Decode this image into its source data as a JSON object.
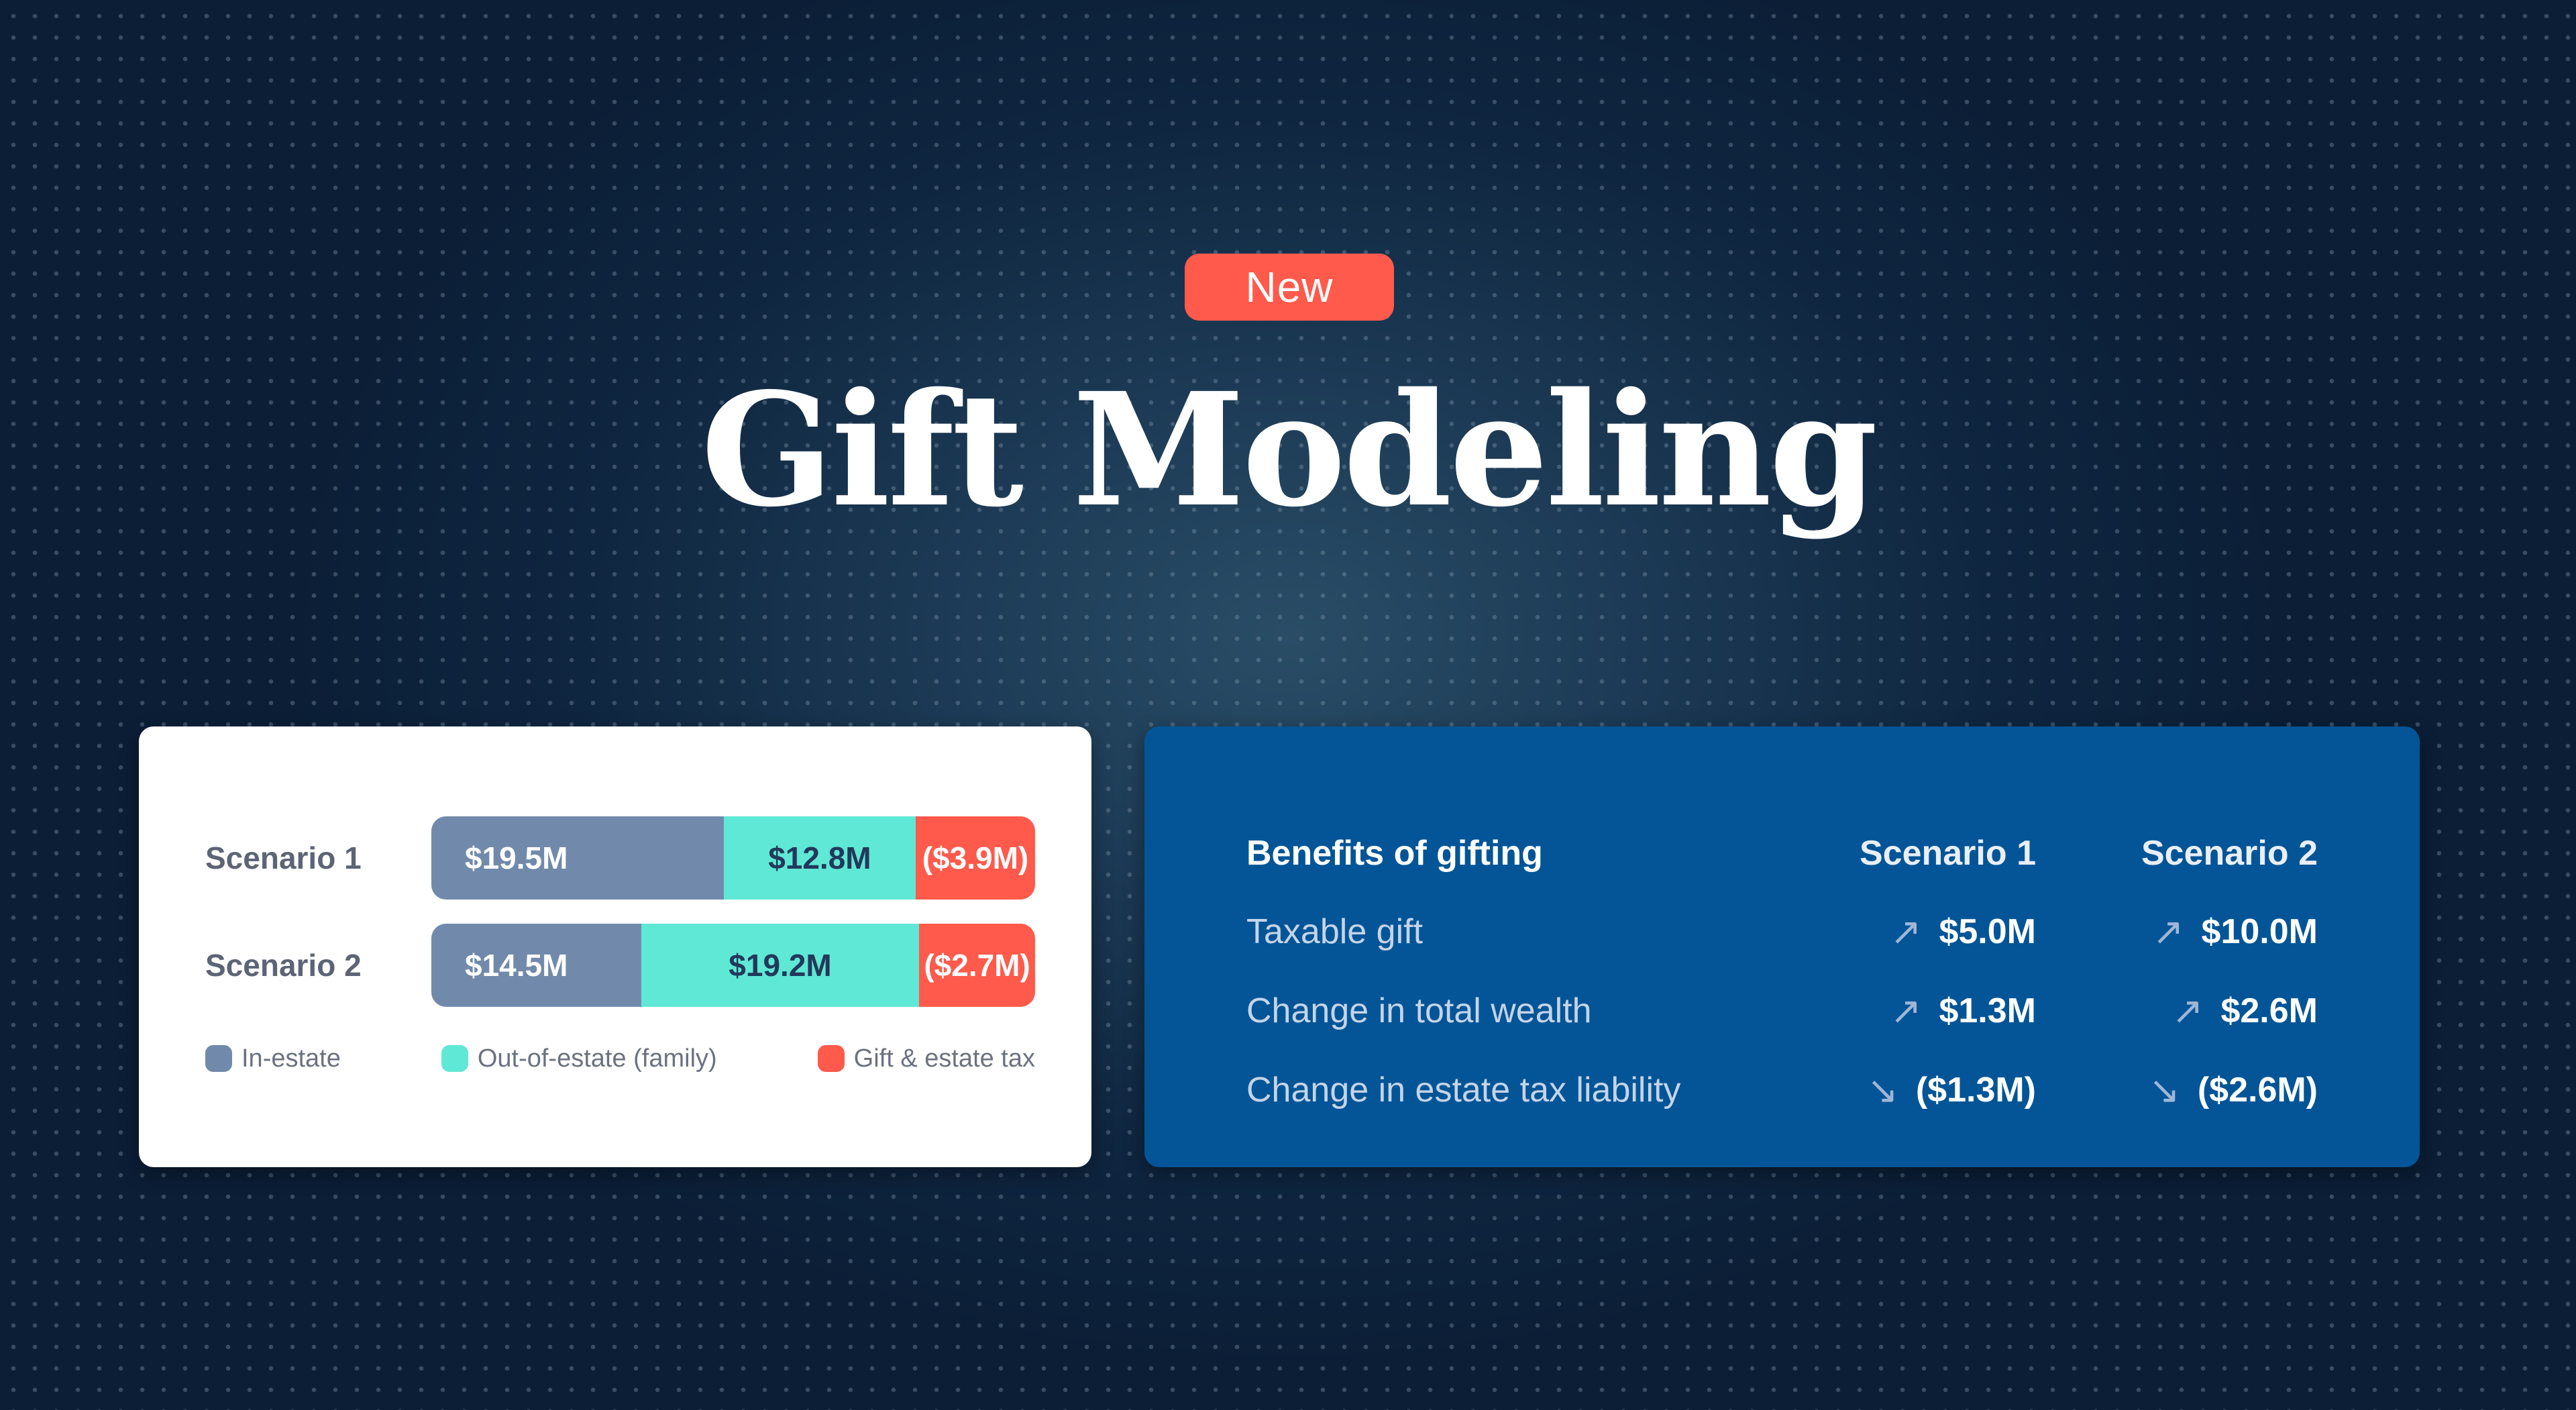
{
  "badge": {
    "label": "New",
    "color": "#ff5a4b"
  },
  "title": "Gift Modeling",
  "colors": {
    "in_estate": "#718aab",
    "out_of_estate": "#5fe8d5",
    "tax": "#ff5a4b",
    "panel_blue": "#035597"
  },
  "chart_data": {
    "type": "bar",
    "orientation": "horizontal",
    "stacked": true,
    "categories": [
      "Scenario 1",
      "Scenario 2"
    ],
    "series": [
      {
        "name": "In-estate",
        "values": [
          19.5,
          14.5
        ],
        "labels": [
          "$19.5M",
          "$14.5M"
        ],
        "color": "#718aab"
      },
      {
        "name": "Out-of-estate (family)",
        "values": [
          12.8,
          19.2
        ],
        "labels": [
          "$12.8M",
          "$19.2M"
        ],
        "color": "#5fe8d5"
      },
      {
        "name": "Gift & estate tax",
        "values": [
          -3.9,
          -2.7
        ],
        "labels": [
          "($3.9M)",
          "($2.7M)"
        ],
        "color": "#ff5a4b"
      }
    ],
    "units": "$M",
    "legend": [
      "In-estate",
      "Out-of-estate (family)",
      "Gift & estate tax"
    ],
    "legend_position": "bottom",
    "title": "",
    "xlabel": "",
    "ylabel": ""
  },
  "benefits": {
    "header": {
      "label": "Benefits of gifting",
      "col1": "Scenario 1",
      "col2": "Scenario 2"
    },
    "rows": [
      {
        "label": "Taxable gift",
        "s1": "$5.0M",
        "s1_dir": "up",
        "s2": "$10.0M",
        "s2_dir": "up"
      },
      {
        "label": "Change in total wealth",
        "s1": "$1.3M",
        "s1_dir": "up",
        "s2": "$2.6M",
        "s2_dir": "up"
      },
      {
        "label": "Change in estate tax liability",
        "s1": "($1.3M)",
        "s1_dir": "down",
        "s2": "($2.6M)",
        "s2_dir": "down"
      }
    ],
    "icons": {
      "up": "arrow-up-right-icon",
      "down": "arrow-down-right-icon"
    }
  }
}
